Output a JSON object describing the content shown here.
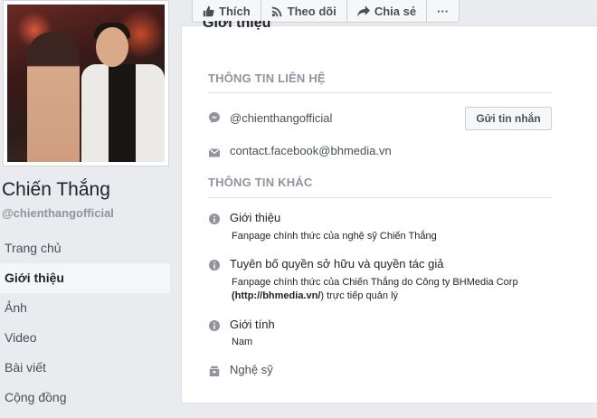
{
  "profile": {
    "name": "Chiến Thắng",
    "handle": "@chienthangofficial"
  },
  "nav": {
    "items": [
      {
        "label": "Trang chủ",
        "active": false
      },
      {
        "label": "Giới thiệu",
        "active": true
      },
      {
        "label": "Ảnh",
        "active": false
      },
      {
        "label": "Video",
        "active": false
      },
      {
        "label": "Bài viết",
        "active": false
      },
      {
        "label": "Cộng đồng",
        "active": false
      }
    ]
  },
  "actions": {
    "like": "Thích",
    "follow": "Theo dõi",
    "share": "Chia sẻ",
    "more": "···"
  },
  "about": {
    "title": "Giới thiệu",
    "contact_header": "THÔNG TIN LIÊN HỆ",
    "messenger": "@chienthangofficial",
    "message_button": "Gửi tin nhắn",
    "email": "contact.facebook@bhmedia.vn",
    "other_header": "THÔNG TIN KHÁC",
    "intro_title": "Giới thiệu",
    "intro_text": "Fanpage chính thức của nghệ sỹ Chiến Thắng",
    "copyright_title": "Tuyên bố quyền sở hữu và quyền tác giả",
    "copyright_line1": "Fanpage chính thức của Chiến Thắng do Công ty BHMedia Corp",
    "copyright_link": "(http://bhmedia.vn/",
    "copyright_line2_rest": ") trực tiếp quản lý",
    "gender_title": "Giới tính",
    "gender_value": "Nam",
    "category": "Nghệ sỹ"
  },
  "colors": {
    "background": "#e9ebee",
    "card": "#ffffff",
    "muted_text": "#90949c",
    "icon_gray": "#90949c"
  }
}
